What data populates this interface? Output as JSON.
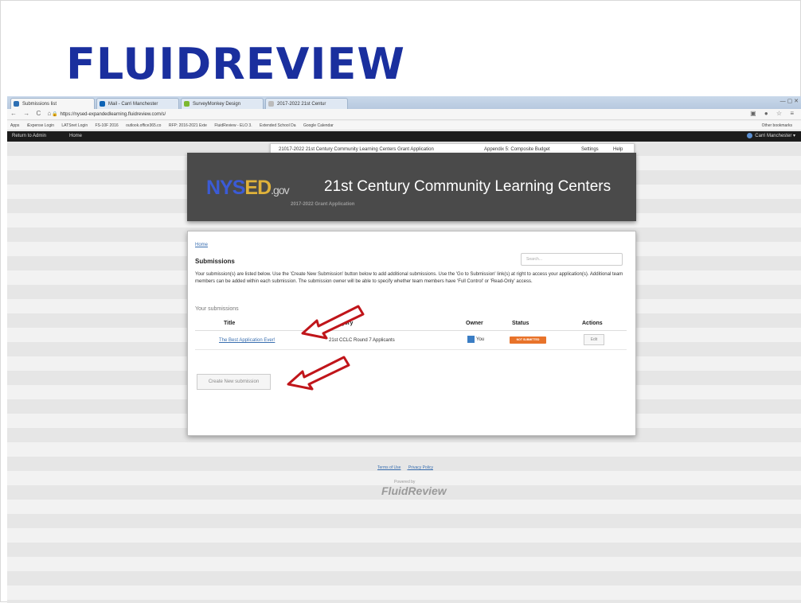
{
  "slide": {
    "title": "FLUIDREVIEW"
  },
  "browser": {
    "tabs": [
      {
        "label": "Submissions list",
        "icon_color": "#2d6fb3"
      },
      {
        "label": "Mail - Carri Manchester",
        "icon_color": "#0b62b5"
      },
      {
        "label": "SurveyMonkey Design",
        "icon_color": "#7cb82f"
      },
      {
        "label": "2017-2022 21st Centur",
        "icon_color": "#bbbbbb"
      }
    ],
    "url": "https://nysed-expandedlearning.fluidreview.com/s/",
    "bookmarks": [
      "Apps",
      "iExpense Login",
      "LATSnet Login",
      "FS-10F 2016",
      "outlook.office365.co",
      "RFP: 2016-2021 Exte",
      "FluidReview - ELO 3.",
      "Extended School Da",
      "Google Calendar"
    ],
    "other_bookmarks": "Other bookmarks"
  },
  "topnav": {
    "return_admin": "Return to Admin",
    "home": "Home",
    "user": "Carri Manchester"
  },
  "program_menu": {
    "program": "21017-2022 21st Century Community Learning Centers Grant Application",
    "appendix": "Appendix 5: Composite Budget",
    "settings": "Settings",
    "help": "Help"
  },
  "banner": {
    "logo_ny": "NYS",
    "logo_ed": "ED",
    "logo_gov": ".gov",
    "title": "21st Century Community Learning Centers",
    "subtitle": "2017-2022 Grant Application"
  },
  "card": {
    "breadcrumb": "Home",
    "heading": "Submissions",
    "search_placeholder": "Search...",
    "description": "Your submission(s) are listed below. Use the 'Create New Submission' button below to add additional submissions. Use the 'Go to Submission' link(s) at right to access your application(s). Additional team members can be added within each submission. The submission owner will be able to specify whether team members have 'Full Control' or 'Read-Only' access.",
    "your_submissions": "Your submissions",
    "table": {
      "headers": {
        "title": "Title",
        "category": "Category",
        "owner": "Owner",
        "status": "Status",
        "actions": "Actions"
      },
      "row": {
        "title": "The Best Application Ever!",
        "category": "21st CCLC Round 7 Applicants",
        "owner": "You",
        "status": "NOT SUBMITTED",
        "action": "Edit"
      }
    },
    "create_button": "Create New submission"
  },
  "footer": {
    "terms": "Terms of Use",
    "privacy": "Privacy Policy",
    "powered_by": "Powered by",
    "brand": "FluidReview"
  },
  "colors": {
    "title_blue": "#1a2f9e",
    "arrow_red": "#c0151a",
    "badge_orange": "#e8732a"
  }
}
